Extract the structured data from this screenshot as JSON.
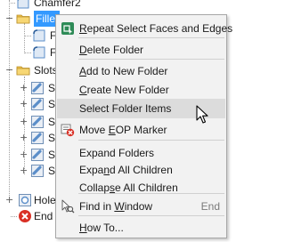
{
  "tree": {
    "nodes": [
      {
        "label": "Chamfer2",
        "icon": "chamfer-feature-icon"
      },
      {
        "label": "Fillet",
        "icon": "folder-icon",
        "selected": true
      },
      {
        "label": "F",
        "icon": "fillet-feature-icon"
      },
      {
        "label": "F",
        "icon": "fillet-feature-icon"
      },
      {
        "label": "Slots",
        "icon": "folder-icon"
      },
      {
        "label": "S",
        "icon": "slot-feature-icon"
      },
      {
        "label": "S",
        "icon": "slot-feature-icon"
      },
      {
        "label": "S",
        "icon": "slot-feature-icon"
      },
      {
        "label": "S",
        "icon": "slot-feature-icon"
      },
      {
        "label": "S",
        "icon": "slot-feature-icon"
      },
      {
        "label": "S",
        "icon": "slot-feature-icon"
      },
      {
        "label": "Hole",
        "icon": "hole-feature-icon"
      },
      {
        "label": "End o",
        "icon": "end-of-part-icon"
      }
    ]
  },
  "context_menu": {
    "items": [
      {
        "pre": "",
        "u": "R",
        "post": "epeat Select Faces and Edges",
        "icon": "select-faces-icon"
      },
      {
        "pre": "",
        "u": "D",
        "post": "elete Folder"
      },
      {
        "pre": "",
        "u": "A",
        "post": "dd to New Folder"
      },
      {
        "pre": "",
        "u": "C",
        "post": "reate New Folder"
      },
      {
        "pre": "Select Folder Items",
        "u": "",
        "post": ""
      },
      {
        "pre": "Move ",
        "u": "E",
        "post": "OP Marker",
        "icon": "move-eop-marker-icon"
      },
      {
        "pre": "Expand Folders",
        "u": "",
        "post": ""
      },
      {
        "pre": "Expa",
        "u": "n",
        "post": "d All Children"
      },
      {
        "pre": "Collap",
        "u": "s",
        "post": "e All Children"
      },
      {
        "pre": "Find in ",
        "u": "W",
        "post": "indow",
        "shortcut": "End",
        "icon": "find-in-window-icon"
      },
      {
        "pre": "",
        "u": "H",
        "post": "ow To..."
      }
    ],
    "highlighted_index": 4
  },
  "colors": {
    "selection": "#3399ff",
    "menu_bg": "#f2f2f2",
    "menu_hover": "#dcdcdc",
    "folder": "#f0c24a",
    "feature": "#5b8ec9",
    "error": "#d93025"
  }
}
